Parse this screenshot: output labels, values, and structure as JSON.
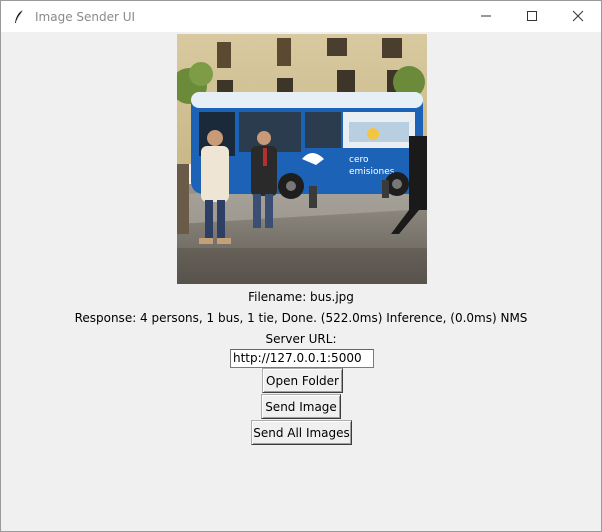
{
  "window": {
    "title": "Image Sender UI",
    "app_icon": "feather-icon",
    "controls": [
      "minimize-icon",
      "maximize-icon",
      "close-icon"
    ]
  },
  "image": {
    "alt": "bus photo with pedestrians",
    "bus_text_1": "cero",
    "bus_text_2": "emisiones"
  },
  "main": {
    "filename_label": "Filename: bus.jpg",
    "response_label": "Response: 4 persons, 1 bus, 1 tie, Done. (522.0ms) Inference, (0.0ms) NMS",
    "server_url_label": "Server URL:",
    "server_url_value": "http://127.0.0.1:5000",
    "open_folder_label": "Open Folder",
    "send_image_label": "Send Image",
    "send_all_label": "Send All Images"
  },
  "colors": {
    "window_bg": "#f0f0f0",
    "titlebar_bg": "#ffffff",
    "bus_blue": "#1c63b8"
  }
}
